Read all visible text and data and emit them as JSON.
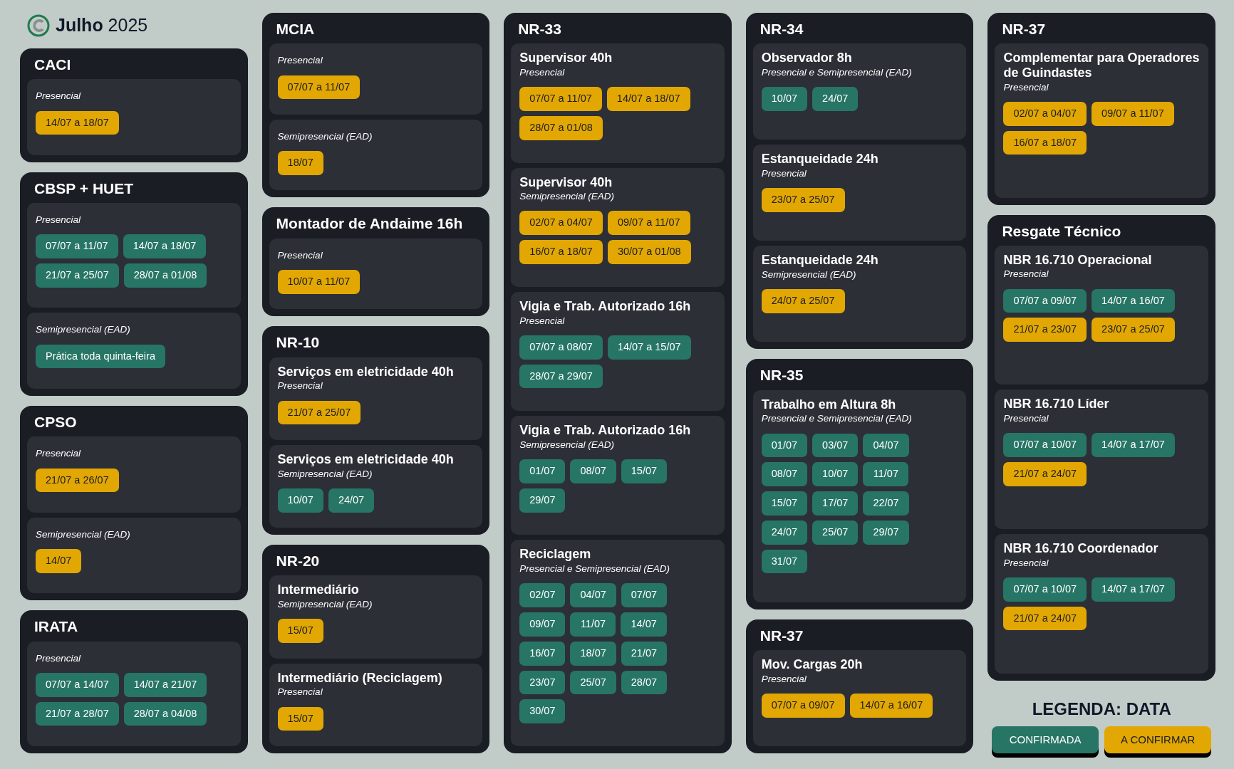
{
  "header": {
    "month": "Julho",
    "year": "2025"
  },
  "columns": [
    {
      "cards": [
        {
          "title": "CACI",
          "sections": [
            {
              "mode": "Presencial",
              "dates": [
                {
                  "text": "14/07 a 18/07",
                  "confirmed": false
                }
              ]
            }
          ]
        },
        {
          "title": "CBSP + HUET",
          "sections": [
            {
              "mode": "Presencial",
              "dates": [
                {
                  "text": "07/07 a 11/07",
                  "confirmed": true
                },
                {
                  "text": "14/07 a 18/07",
                  "confirmed": true
                },
                {
                  "text": "21/07 a 25/07",
                  "confirmed": true
                },
                {
                  "text": "28/07 a 01/08",
                  "confirmed": true
                }
              ]
            },
            {
              "mode": "Semipresencial (EAD)",
              "dates": [
                {
                  "text": "Prática toda quinta-feira",
                  "confirmed": true
                }
              ]
            }
          ]
        },
        {
          "title": "CPSO",
          "sections": [
            {
              "mode": "Presencial",
              "dates": [
                {
                  "text": "21/07 a 26/07",
                  "confirmed": false
                }
              ]
            },
            {
              "mode": "Semipresencial (EAD)",
              "dates": [
                {
                  "text": "14/07",
                  "confirmed": false
                }
              ]
            }
          ]
        },
        {
          "title": "IRATA",
          "sections": [
            {
              "mode": "Presencial",
              "dates": [
                {
                  "text": "07/07 a 14/07",
                  "confirmed": true
                },
                {
                  "text": "14/07 a 21/07",
                  "confirmed": true
                },
                {
                  "text": "21/07 a 28/07",
                  "confirmed": true
                },
                {
                  "text": "28/07 a 04/08",
                  "confirmed": true
                }
              ]
            }
          ]
        }
      ]
    },
    {
      "cards": [
        {
          "title": "MCIA",
          "sections": [
            {
              "mode": "Presencial",
              "dates": [
                {
                  "text": "07/07 a 11/07",
                  "confirmed": false
                }
              ]
            },
            {
              "mode": "Semipresencial (EAD)",
              "dates": [
                {
                  "text": "18/07",
                  "confirmed": false
                }
              ]
            }
          ]
        },
        {
          "title": "Montador de Andaime 16h",
          "sections": [
            {
              "mode": "Presencial",
              "dates": [
                {
                  "text": "10/07 a 11/07",
                  "confirmed": false
                }
              ]
            }
          ]
        },
        {
          "title": "NR-10",
          "sections": [
            {
              "course": "Serviços em eletricidade 40h",
              "mode": "Presencial",
              "dates": [
                {
                  "text": "21/07 a 25/07",
                  "confirmed": false
                }
              ]
            },
            {
              "course": "Serviços em eletricidade 40h",
              "mode": "Semipresencial (EAD)",
              "dates": [
                {
                  "text": "10/07",
                  "confirmed": true
                },
                {
                  "text": "24/07",
                  "confirmed": true
                }
              ]
            }
          ]
        },
        {
          "title": "NR-20",
          "sections": [
            {
              "course": "Intermediário",
              "mode": "Semipresencial (EAD)",
              "dates": [
                {
                  "text": "15/07",
                  "confirmed": false
                }
              ]
            },
            {
              "course": "Intermediário (Reciclagem)",
              "mode": "Presencial",
              "dates": [
                {
                  "text": "15/07",
                  "confirmed": false
                }
              ]
            }
          ]
        }
      ]
    },
    {
      "cards": [
        {
          "title": "NR-33",
          "sections": [
            {
              "course": "Supervisor 40h",
              "mode": "Presencial",
              "dates": [
                {
                  "text": "07/07 a 11/07",
                  "confirmed": false
                },
                {
                  "text": "14/07 a 18/07",
                  "confirmed": false
                },
                {
                  "text": "28/07 a 01/08",
                  "confirmed": false
                }
              ]
            },
            {
              "course": "Supervisor 40h",
              "mode": "Semipresencial (EAD)",
              "dates": [
                {
                  "text": "02/07 a 04/07",
                  "confirmed": false
                },
                {
                  "text": "09/07 a 11/07",
                  "confirmed": false
                },
                {
                  "text": "16/07 a 18/07",
                  "confirmed": false
                },
                {
                  "text": "30/07 a 01/08",
                  "confirmed": false
                }
              ]
            },
            {
              "course": "Vigia e Trab. Autorizado 16h",
              "mode": "Presencial",
              "dates": [
                {
                  "text": "07/07 a 08/07",
                  "confirmed": true
                },
                {
                  "text": "14/07 a 15/07",
                  "confirmed": true
                },
                {
                  "text": "28/07 a 29/07",
                  "confirmed": true
                }
              ]
            },
            {
              "course": "Vigia e Trab. Autorizado 16h",
              "mode": "Semipresencial (EAD)",
              "dates": [
                {
                  "text": "01/07",
                  "confirmed": true
                },
                {
                  "text": "08/07",
                  "confirmed": true
                },
                {
                  "text": "15/07",
                  "confirmed": true
                },
                {
                  "text": "29/07",
                  "confirmed": true
                }
              ]
            },
            {
              "course": "Reciclagem",
              "mode": "Presencial e Semipresencial (EAD)",
              "dates": [
                {
                  "text": "02/07",
                  "confirmed": true
                },
                {
                  "text": "04/07",
                  "confirmed": true
                },
                {
                  "text": "07/07",
                  "confirmed": true
                },
                {
                  "text": "09/07",
                  "confirmed": true
                },
                {
                  "text": "11/07",
                  "confirmed": true
                },
                {
                  "text": "14/07",
                  "confirmed": true
                },
                {
                  "text": "16/07",
                  "confirmed": true
                },
                {
                  "text": "18/07",
                  "confirmed": true
                },
                {
                  "text": "21/07",
                  "confirmed": true
                },
                {
                  "text": "23/07",
                  "confirmed": true
                },
                {
                  "text": "25/07",
                  "confirmed": true
                },
                {
                  "text": "28/07",
                  "confirmed": true
                },
                {
                  "text": "30/07",
                  "confirmed": true
                }
              ]
            }
          ]
        }
      ]
    },
    {
      "cards": [
        {
          "title": "NR-34",
          "sections": [
            {
              "course": "Observador 8h",
              "mode": "Presencial e Semipresencial (EAD)",
              "dates": [
                {
                  "text": "10/07",
                  "confirmed": true
                },
                {
                  "text": "24/07",
                  "confirmed": true
                }
              ]
            },
            {
              "course": "Estanqueidade 24h",
              "mode": "Presencial",
              "dates": [
                {
                  "text": "23/07 a 25/07",
                  "confirmed": false
                }
              ]
            },
            {
              "course": "Estanqueidade 24h",
              "mode": "Semipresencial (EAD)",
              "dates": [
                {
                  "text": "24/07 a 25/07",
                  "confirmed": false
                }
              ]
            }
          ]
        },
        {
          "title": "NR-35",
          "sections": [
            {
              "course": "Trabalho em Altura 8h",
              "mode": "Presencial e Semipresencial (EAD)",
              "dates": [
                {
                  "text": "01/07",
                  "confirmed": true
                },
                {
                  "text": "03/07",
                  "confirmed": true
                },
                {
                  "text": "04/07",
                  "confirmed": true
                },
                {
                  "text": "08/07",
                  "confirmed": true
                },
                {
                  "text": "10/07",
                  "confirmed": true
                },
                {
                  "text": "11/07",
                  "confirmed": true
                },
                {
                  "text": "15/07",
                  "confirmed": true
                },
                {
                  "text": "17/07",
                  "confirmed": true
                },
                {
                  "text": "22/07",
                  "confirmed": true
                },
                {
                  "text": "24/07",
                  "confirmed": true
                },
                {
                  "text": "25/07",
                  "confirmed": true
                },
                {
                  "text": "29/07",
                  "confirmed": true
                },
                {
                  "text": "31/07",
                  "confirmed": true
                }
              ]
            }
          ]
        },
        {
          "title": "NR-37",
          "sections": [
            {
              "course": "Mov. Cargas 20h",
              "mode": "Presencial",
              "dates": [
                {
                  "text": "07/07 a 09/07",
                  "confirmed": false
                },
                {
                  "text": "14/07 a 16/07",
                  "confirmed": false
                }
              ]
            }
          ]
        }
      ]
    },
    {
      "cards": [
        {
          "title": "NR-37",
          "sections": [
            {
              "course": "Complementar para Operadores de Guindastes",
              "mode": "Presencial",
              "dates": [
                {
                  "text": "02/07 a 04/07",
                  "confirmed": false
                },
                {
                  "text": "09/07 a 11/07",
                  "confirmed": false
                },
                {
                  "text": "16/07 a 18/07",
                  "confirmed": false
                }
              ]
            }
          ]
        },
        {
          "title": "Resgate Técnico",
          "sections": [
            {
              "course": "NBR 16.710 Operacional",
              "mode": "Presencial",
              "dates": [
                {
                  "text": "07/07 a 09/07",
                  "confirmed": true
                },
                {
                  "text": "14/07 a 16/07",
                  "confirmed": true
                },
                {
                  "text": "21/07 a 23/07",
                  "confirmed": false
                },
                {
                  "text": "23/07 a 25/07",
                  "confirmed": false
                }
              ]
            },
            {
              "course": "NBR 16.710 Líder",
              "mode": "Presencial",
              "dates": [
                {
                  "text": "07/07 a 10/07",
                  "confirmed": true
                },
                {
                  "text": "14/07 a 17/07",
                  "confirmed": true
                },
                {
                  "text": "21/07 a 24/07",
                  "confirmed": false
                }
              ]
            },
            {
              "course": "NBR 16.710 Coordenador",
              "mode": "Presencial",
              "dates": [
                {
                  "text": "07/07 a 10/07",
                  "confirmed": true
                },
                {
                  "text": "14/07 a 17/07",
                  "confirmed": true
                },
                {
                  "text": "21/07 a 24/07",
                  "confirmed": false
                }
              ]
            }
          ]
        }
      ]
    }
  ],
  "legend": {
    "title": "LEGENDA: DATA",
    "items": [
      {
        "label": "CONFIRMADA",
        "confirmed": true
      },
      {
        "label": "A CONFIRMAR",
        "confirmed": false
      }
    ]
  }
}
